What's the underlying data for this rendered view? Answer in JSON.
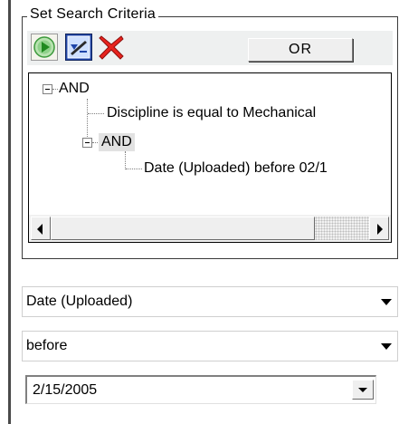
{
  "group": {
    "title": "Set Search Criteria"
  },
  "toolbar": {
    "run_icon": "run-query-icon",
    "filter_icon": "edit-criteria-icon",
    "delete_icon": "delete-icon",
    "or_label": "OR"
  },
  "tree": {
    "root": {
      "label": "AND",
      "expanded": true
    },
    "child1": {
      "label": "Discipline is equal to Mechanical"
    },
    "child2": {
      "label": "AND",
      "expanded": true,
      "selected": true
    },
    "grandchild1": {
      "label": "Date (Uploaded) before 02/1"
    }
  },
  "field_select": {
    "value": "Date (Uploaded)"
  },
  "operator_select": {
    "value": "before"
  },
  "date_picker": {
    "value": "2/15/2005"
  }
}
